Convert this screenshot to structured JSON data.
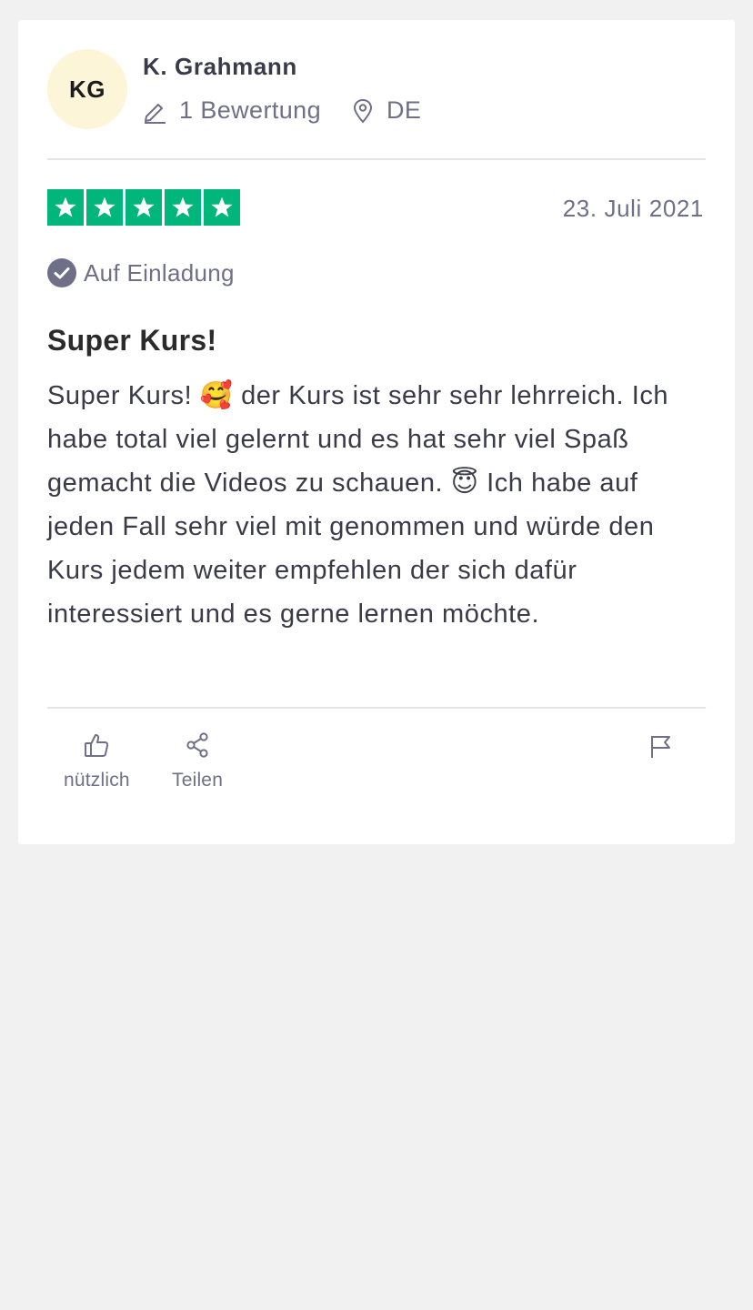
{
  "reviewer": {
    "initials": "KG",
    "name": "K. Grahmann",
    "review_count": "1 Bewertung",
    "country": "DE"
  },
  "review": {
    "rating": 5,
    "date": "23. Juli 2021",
    "invite_label": "Auf Einladung",
    "title": "Super Kurs!",
    "body_part1": "Super Kurs! ",
    "emoji1": "🥰",
    "body_part2": " der Kurs ist sehr sehr lehrreich. Ich habe total viel gelernt und es hat sehr viel Spaß gemacht die Videos zu schauen. ",
    "emoji2": "😇",
    "body_part3": " Ich habe auf jeden Fall sehr viel mit genommen und würde den Kurs jedem weiter empfehlen der sich dafür interessiert und es gerne lernen möchte."
  },
  "actions": {
    "useful_label": "nützlich",
    "share_label": "Teilen"
  },
  "colors": {
    "star_green": "#00b67a",
    "muted_text": "#6f6f87",
    "avatar_bg": "#fcf5d8",
    "page_bg": "#f1f1f1"
  },
  "icons": {
    "review_count": "pencil-icon",
    "country": "location-pin-icon",
    "invite": "check-circle-icon",
    "useful": "thumbs-up-icon",
    "share": "share-icon",
    "report": "flag-icon",
    "star": "star-icon"
  }
}
